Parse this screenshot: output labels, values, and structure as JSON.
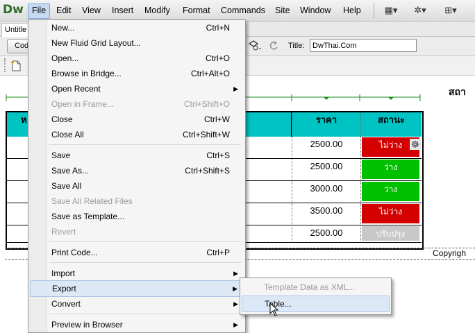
{
  "app": {
    "logo": "Dw"
  },
  "menubar": {
    "items": [
      "File",
      "Edit",
      "View",
      "Insert",
      "Modify",
      "Format",
      "Commands",
      "Site",
      "Window",
      "Help"
    ],
    "icons": [
      "layout-icon",
      "gear-icon",
      "site-icon"
    ]
  },
  "document": {
    "tab_label": "Untitle",
    "code_button": "Cod",
    "title_label": "Title:",
    "title_value": "DwThai.Com"
  },
  "page": {
    "site_heading": "สถา",
    "copyright": "Copyrigh"
  },
  "table": {
    "headers": [
      "ห",
      "ราคา",
      "สถานะ"
    ],
    "rows": [
      {
        "price": "2500.00",
        "status": "ไม่ว่าง",
        "status_color": "#d40000"
      },
      {
        "price": "2500.00",
        "status": "ว่าง",
        "status_color": "#00c000"
      },
      {
        "price": "3000.00",
        "status": "ว่าง",
        "status_color": "#00c000"
      },
      {
        "price": "3500.00",
        "status": "ไม่ว่าง",
        "status_color": "#d40000"
      },
      {
        "price": "2500.00",
        "status": "ปรับปรุง",
        "status_color": "#c8c8c8"
      }
    ]
  },
  "file_menu": {
    "items": [
      {
        "label": "New...",
        "shortcut": "Ctrl+N"
      },
      {
        "label": "New Fluid Grid Layout...",
        "shortcut": ""
      },
      {
        "label": "Open...",
        "shortcut": "Ctrl+O"
      },
      {
        "label": "Browse in Bridge...",
        "shortcut": "Ctrl+Alt+O"
      },
      {
        "label": "Open Recent",
        "shortcut": ""
      },
      {
        "label": "Open in Frame...",
        "shortcut": "Ctrl+Shift+O"
      },
      {
        "label": "Close",
        "shortcut": "Ctrl+W"
      },
      {
        "label": "Close All",
        "shortcut": "Ctrl+Shift+W"
      },
      {
        "label": "Save",
        "shortcut": "Ctrl+S"
      },
      {
        "label": "Save As...",
        "shortcut": "Ctrl+Shift+S"
      },
      {
        "label": "Save All",
        "shortcut": ""
      },
      {
        "label": "Save All Related Files",
        "shortcut": ""
      },
      {
        "label": "Save as Template...",
        "shortcut": ""
      },
      {
        "label": "Revert",
        "shortcut": ""
      },
      {
        "label": "Print Code...",
        "shortcut": "Ctrl+P"
      },
      {
        "label": "Import",
        "shortcut": ""
      },
      {
        "label": "Export",
        "shortcut": ""
      },
      {
        "label": "Convert",
        "shortcut": ""
      },
      {
        "label": "Preview in Browser",
        "shortcut": ""
      }
    ]
  },
  "export_submenu": {
    "items": [
      "Template Data as XML...",
      "Table..."
    ]
  },
  "colors": {
    "header_cyan": "#00c4c4",
    "menu_highlight": "#dde8f6"
  }
}
